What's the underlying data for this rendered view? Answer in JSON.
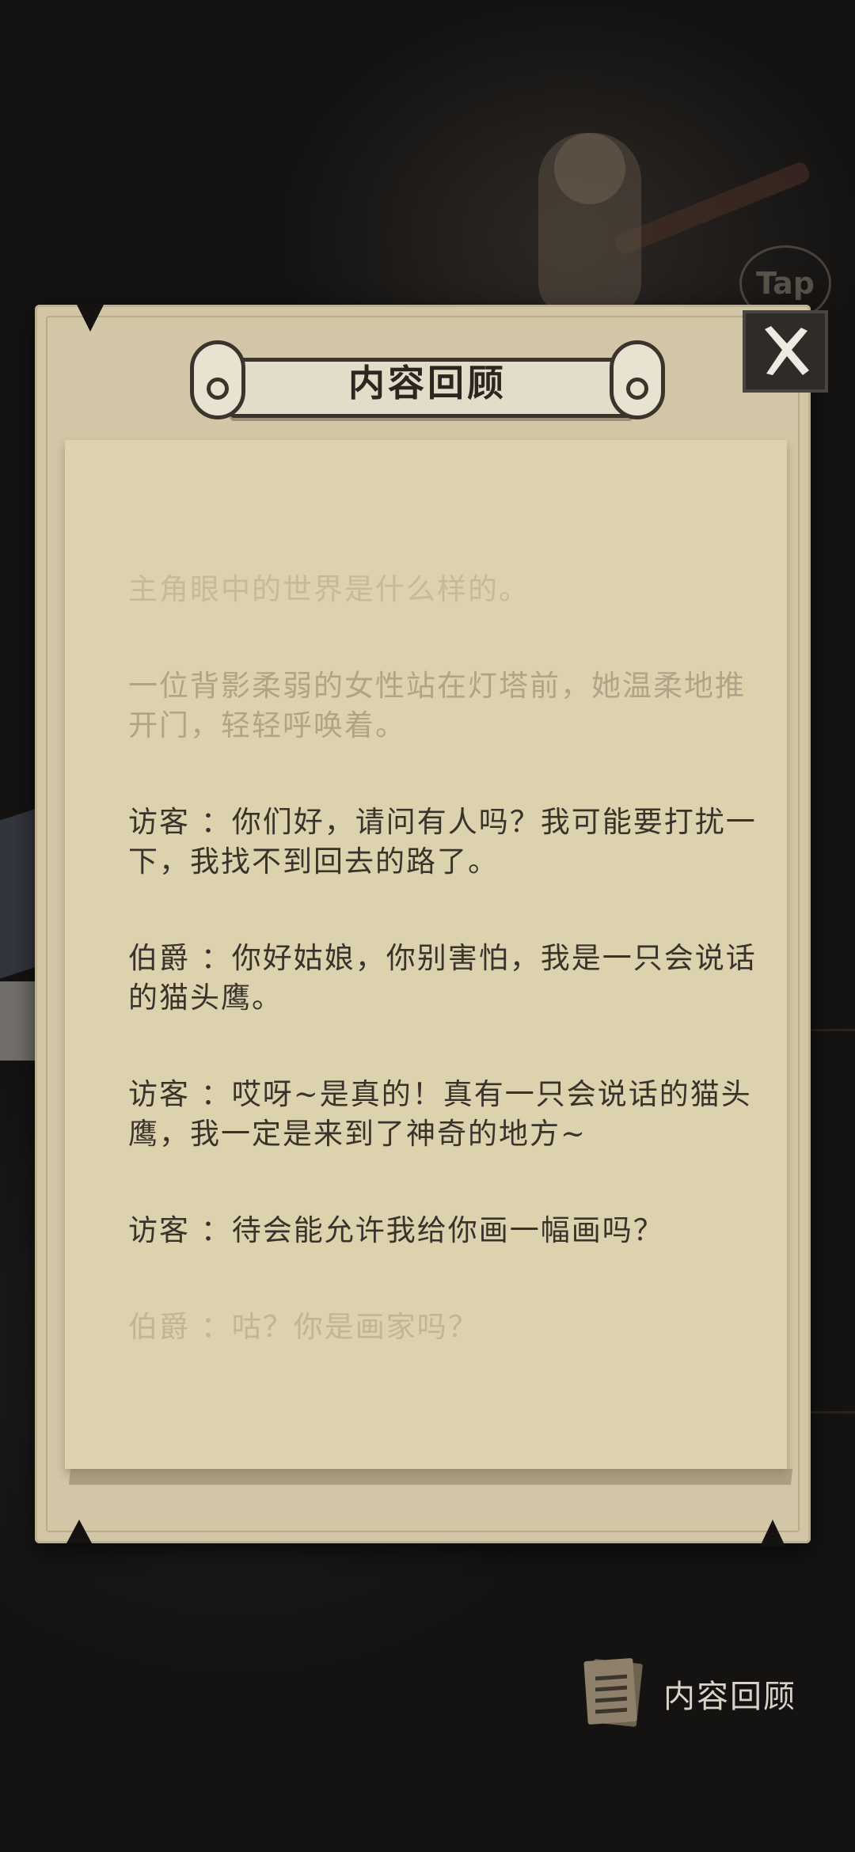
{
  "header": {
    "title": "内容回顾"
  },
  "background": {
    "tap_badge": "Tap"
  },
  "dialogue": [
    {
      "text": "主角眼中的世界是什么样的。",
      "style": "fade-top"
    },
    {
      "text": "一位背影柔弱的女性站在灯塔前，她温柔地推开门，轻轻呼唤着。",
      "style": "fade"
    },
    {
      "text": "访客 ：你们好，请问有人吗？我可能要打扰一下，我找不到回去的路了。",
      "style": "normal"
    },
    {
      "text": "伯爵 ：你好姑娘，你别害怕，我是一只会说话的猫头鹰。",
      "style": "normal"
    },
    {
      "text": "访客 ：哎呀~是真的！真有一只会说话的猫头鹰，我一定是来到了神奇的地方~",
      "style": "normal"
    },
    {
      "text": "访客 ：待会能允许我给你画一幅画吗？",
      "style": "normal"
    },
    {
      "text": "伯爵 ：咕？你是画家吗？",
      "style": "fade-bottom"
    }
  ],
  "footer": {
    "review_label": "内容回顾"
  },
  "colors": {
    "panel": "#d2c6a6",
    "paper": "#ddd2ae",
    "text": "#3a332c"
  },
  "icons": {
    "close": "close-x-icon",
    "review": "notes-icon"
  }
}
